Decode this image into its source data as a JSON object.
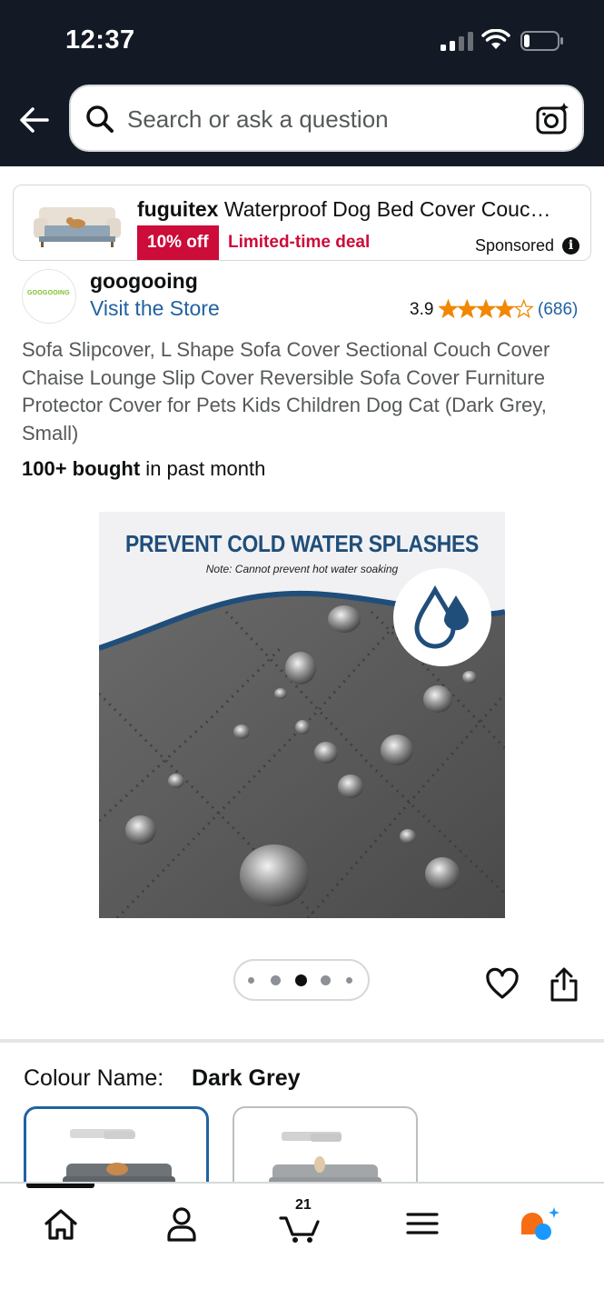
{
  "status_bar": {
    "time": "12:37"
  },
  "search": {
    "placeholder": "Search or ask a question"
  },
  "sponsored_ad": {
    "brand": "fuguitex",
    "title_rest": " Waterproof Dog Bed Cover Couc…",
    "discount_badge": "10% off",
    "deal_label": "Limited-time deal",
    "sponsored_label": "Sponsored"
  },
  "brand": {
    "logo_text": "GOOGOOING",
    "name": "googooing",
    "store_link": "Visit the Store"
  },
  "rating": {
    "value": "3.9",
    "stars": 3.9,
    "count": "(686)"
  },
  "product": {
    "title": "Sofa Slipcover, L Shape Sofa Cover Sectional Couch Cover Chaise Lounge Slip Cover Reversible Sofa Cover Furniture Protector Cover for Pets Kids Children Dog Cat (Dark Grey, Small)",
    "bought_bold": "100+ bought",
    "bought_rest": " in past month"
  },
  "product_image": {
    "headline": "PREVENT COLD WATER SPLASHES",
    "note": "Note: Cannot prevent hot water soaking"
  },
  "carousel": {
    "total": 5,
    "active_index": 2
  },
  "variation": {
    "label": "Colour Name:",
    "selected": "Dark Grey"
  },
  "bottom_nav": {
    "items": [
      "home-icon",
      "account-icon",
      "cart-icon",
      "menu-icon",
      "rufus-icon"
    ],
    "cart_count": "21",
    "active_index": 0
  },
  "colors": {
    "header_bg": "#131a26",
    "link": "#2162a1",
    "deal_red": "#cc0c39",
    "star": "#f08804"
  }
}
